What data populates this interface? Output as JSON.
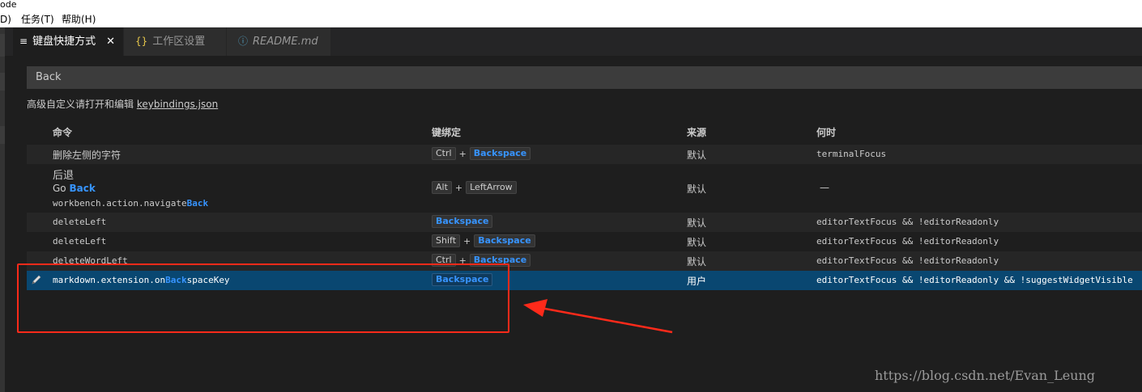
{
  "title_fragment": "ode",
  "menu": [
    {
      "label": "D)"
    },
    {
      "label": "任务(T)"
    },
    {
      "label": "帮助(H)"
    }
  ],
  "tabs": [
    {
      "label": "键盘快捷方式",
      "icon": "≡",
      "close": "✕"
    },
    {
      "label": "工作区设置",
      "icon": "{}"
    },
    {
      "label": "README.md",
      "icon": "ⓘ"
    }
  ],
  "search": {
    "value": "Back"
  },
  "hint": {
    "text": "高级自定义请打开和编辑",
    "link": "keybindings.json"
  },
  "columns": {
    "command": "命令",
    "keybinding": "键绑定",
    "source": "来源",
    "when": "何时"
  },
  "rows": [
    {
      "command": "删除左侧的字符",
      "keys": [
        {
          "pre": "Ctrl"
        },
        {
          "plus": "+"
        },
        {
          "hl": "Backspace"
        }
      ],
      "source": "默认",
      "when": "terminalFocus"
    },
    {
      "command_title": "后退",
      "command_label_pre": "Go ",
      "command_label_hl": "Back",
      "command_id_pre": "workbench.action.navigate",
      "command_id_hl": "Back",
      "keys": [
        {
          "pre": "Alt"
        },
        {
          "plus": "+"
        },
        {
          "pre": "LeftArrow"
        }
      ],
      "source": "默认",
      "when": "—"
    },
    {
      "command": "deleteLeft",
      "keys": [
        {
          "hl": "Backspace"
        }
      ],
      "source": "默认",
      "when": "editorTextFocus && !editorReadonly"
    },
    {
      "command": "deleteLeft",
      "keys": [
        {
          "pre": "Shift"
        },
        {
          "plus": "+"
        },
        {
          "hl": "Backspace"
        }
      ],
      "source": "默认",
      "when": "editorTextFocus && !editorReadonly"
    },
    {
      "command": "deleteWordLeft",
      "keys": [
        {
          "pre": "Ctrl"
        },
        {
          "plus": "+"
        },
        {
          "hl": "Backspace"
        }
      ],
      "source": "默认",
      "when": "editorTextFocus && !editorReadonly"
    },
    {
      "command_pre": "markdown.extension.on",
      "command_hl": "Back",
      "command_post": "spaceKey",
      "keys": [
        {
          "hl": "Backspace"
        }
      ],
      "source": "用户",
      "when": "editorTextFocus && !editorReadonly && !suggestWidgetVisible",
      "selected": true
    }
  ],
  "watermark": "https://blog.csdn.net/Evan_Leung",
  "colors": {
    "accent": "#3794ff",
    "selection": "#094771",
    "annotation": "#ff2a1a"
  }
}
